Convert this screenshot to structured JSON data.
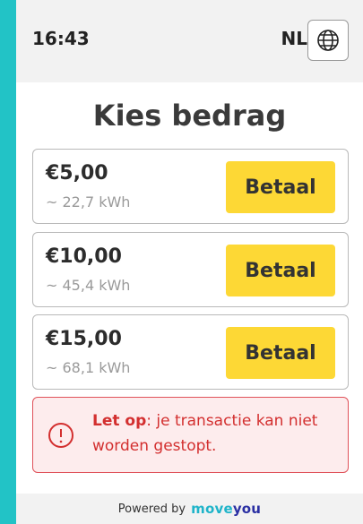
{
  "status_bar": {
    "time": "16:43",
    "language": "NL",
    "globe_icon": "globe-icon"
  },
  "page": {
    "title": "Kies bedrag"
  },
  "options": [
    {
      "amount": "€5,00",
      "energy": "~ 22,7 kWh",
      "button_label": "Betaal"
    },
    {
      "amount": "€10,00",
      "energy": "~ 45,4 kWh",
      "button_label": "Betaal"
    },
    {
      "amount": "€15,00",
      "energy": "~ 68,1 kWh",
      "button_label": "Betaal"
    }
  ],
  "warning": {
    "icon": "alert-circle-icon",
    "bold": "Let op",
    "rest": ": je transactie kan niet worden gestopt."
  },
  "footer": {
    "powered_by": "Powered by",
    "brand_part1": "move",
    "brand_part2": "you"
  },
  "colors": {
    "accent": "#fdd835",
    "brand_teal": "#22c3c6",
    "warning": "#d32f2f"
  }
}
